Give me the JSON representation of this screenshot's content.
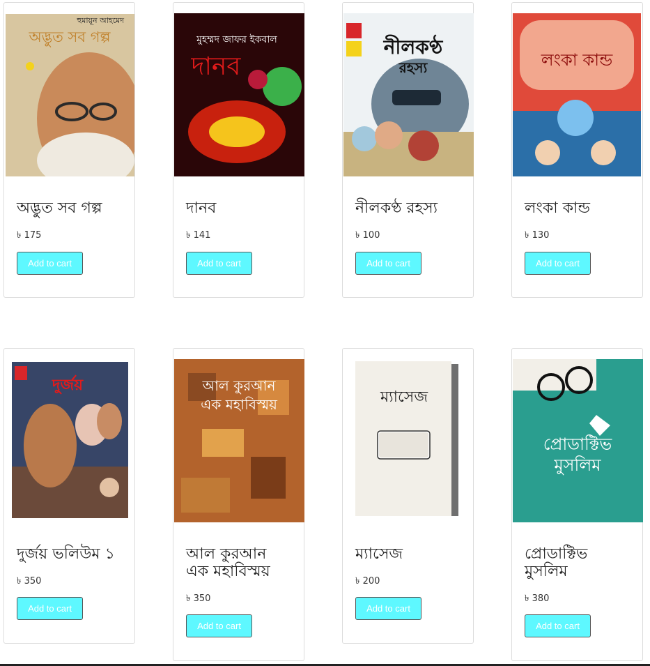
{
  "currency_symbol": "৳",
  "button_color": "#5ef8ff",
  "products": [
    {
      "title": "অদ্ভুত সব গল্প",
      "price": "৳ 175",
      "cart_label": "Add to cart",
      "cover": {
        "author": "হুমায়ূন আহমেদ",
        "title": "অদ্ভুত সব গল্প"
      }
    },
    {
      "title": "দানব",
      "price": "৳ 141",
      "cart_label": "Add to cart",
      "cover": {
        "author": "মুহম্মদ জাফর ইকবাল",
        "title": "দানব"
      }
    },
    {
      "title": "নীলকণ্ঠ রহস্য",
      "price": "৳ 100",
      "cart_label": "Add to cart",
      "cover": {
        "title": "নীলকণ্ঠ",
        "subtitle": "রহস্য"
      }
    },
    {
      "title": "লংকা কান্ড",
      "price": "৳ 130",
      "cart_label": "Add to cart",
      "cover": {
        "title": "লংকা কান্ড"
      }
    },
    {
      "title": "দুর্জয় ভলিউম ১",
      "price": "৳ 350",
      "cart_label": "Add to cart",
      "cover": {
        "title": "দুর্জয়"
      }
    },
    {
      "title": "আল কুরআন এক মহাবিস্ময়",
      "price": "৳ 350",
      "cart_label": "Add to cart",
      "cover": {
        "title": "আল কুরআন",
        "subtitle": "এক মহাবিস্ময়"
      }
    },
    {
      "title": "ম্যাসেজ",
      "price": "৳ 200",
      "cart_label": "Add to cart",
      "cover": {
        "title": "ম্যাসেজ"
      }
    },
    {
      "title": "প্রোডাক্টিভ মুসলিম",
      "price": "৳ 380",
      "cart_label": "Add to cart",
      "cover": {
        "title": "প্রোডাক্টিভ",
        "subtitle": "মুসলিম"
      }
    }
  ]
}
